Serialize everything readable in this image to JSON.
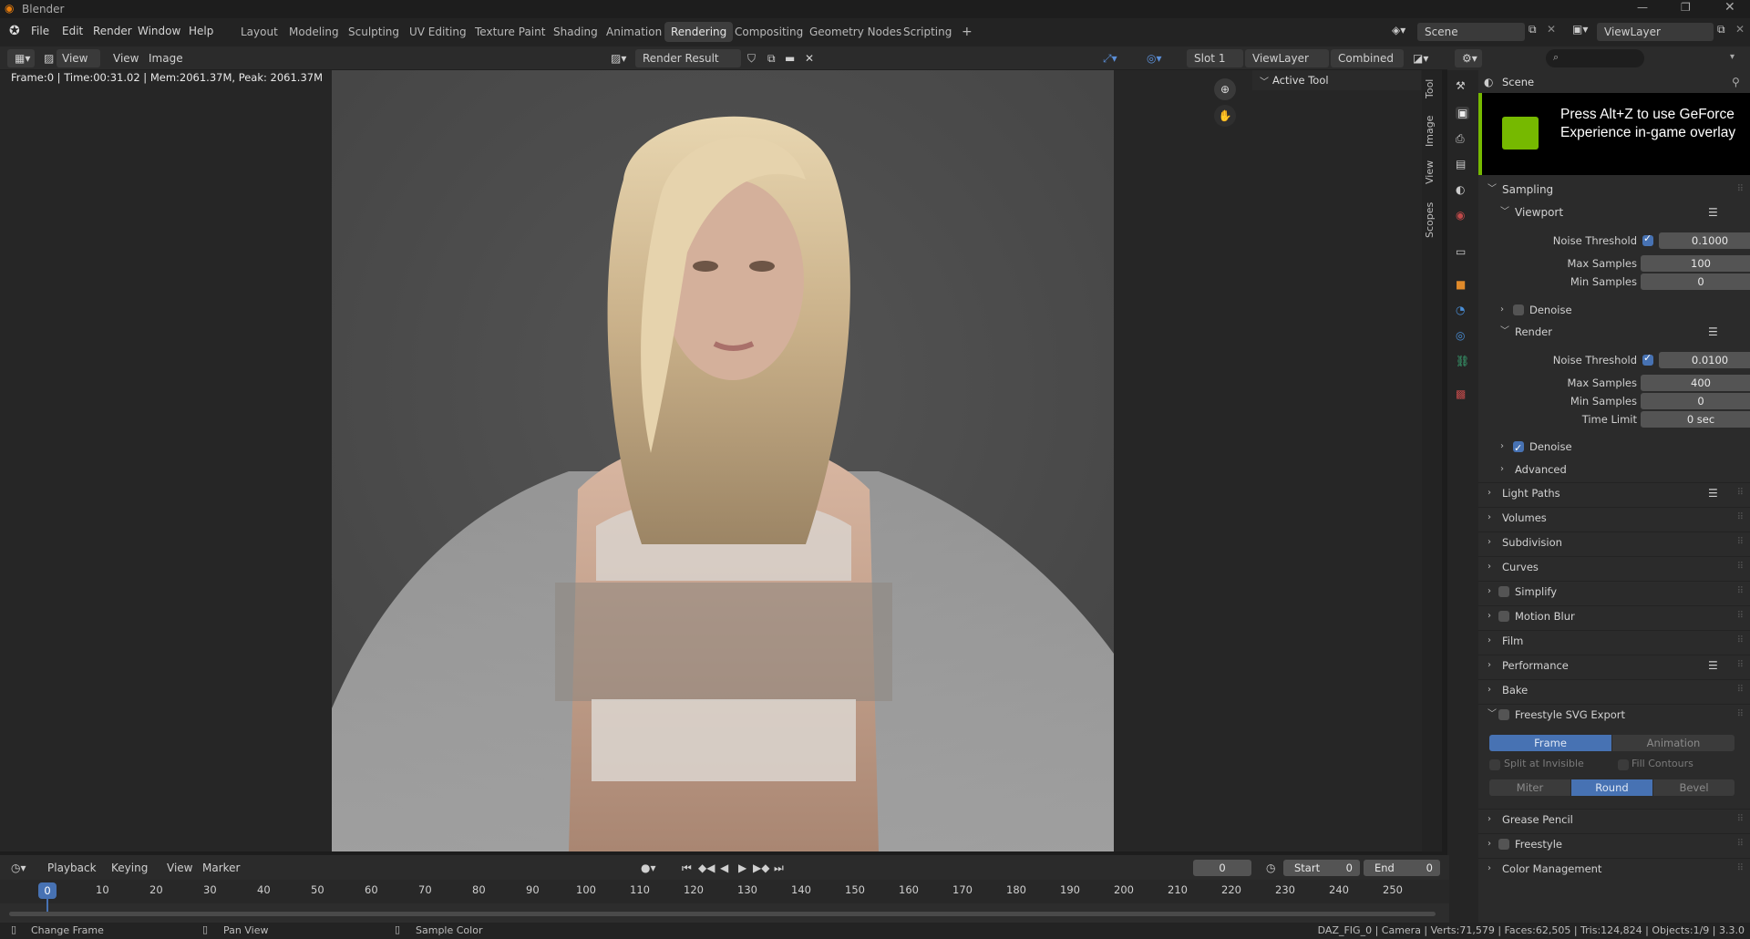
{
  "window": {
    "title": "Blender"
  },
  "menu": [
    "File",
    "Edit",
    "Render",
    "Window",
    "Help"
  ],
  "workspaces": {
    "tabs": [
      "Layout",
      "Modeling",
      "Sculpting",
      "UV Editing",
      "Texture Paint",
      "Shading",
      "Animation",
      "Rendering",
      "Compositing",
      "Geometry Nodes",
      "Scripting"
    ],
    "active": "Rendering",
    "add_label": "+"
  },
  "top_right": {
    "scene": "Scene",
    "view_layer": "ViewLayer"
  },
  "image_editor": {
    "view_menu": "View",
    "menu_view": "View",
    "menu_image": "Image",
    "image_name": "Render Result",
    "slot": "Slot 1",
    "view_layer": "ViewLayer",
    "pass": "Combined",
    "info": "Frame:0 | Time:00:31.02 | Mem:2061.37M, Peak: 2061.37M",
    "active_tool_label": "Active Tool",
    "vertical_tabs": [
      "Tool",
      "Image",
      "View",
      "Scopes"
    ]
  },
  "overlay": {
    "text": "Press Alt+Z to use GeForce Experience in-game overlay"
  },
  "properties": {
    "header": "Scene",
    "sampling": {
      "label": "Sampling",
      "viewport": {
        "label": "Viewport",
        "noise_threshold_label": "Noise Threshold",
        "noise_threshold": "0.1000",
        "max_samples_label": "Max Samples",
        "max_samples": "100",
        "min_samples_label": "Min Samples",
        "min_samples": "0",
        "denoise_label": "Denoise"
      },
      "render": {
        "label": "Render",
        "noise_threshold_label": "Noise Threshold",
        "noise_threshold": "0.0100",
        "max_samples_label": "Max Samples",
        "max_samples": "400",
        "min_samples_label": "Min Samples",
        "min_samples": "0",
        "time_limit_label": "Time Limit",
        "time_limit": "0 sec",
        "denoise_label": "Denoise"
      },
      "advanced_label": "Advanced"
    },
    "sections": {
      "light_paths": "Light Paths",
      "volumes": "Volumes",
      "subdivision": "Subdivision",
      "curves": "Curves",
      "simplify": "Simplify",
      "motion_blur": "Motion Blur",
      "film": "Film",
      "performance": "Performance",
      "bake": "Bake",
      "freestyle_svg": "Freestyle SVG Export",
      "grease_pencil": "Grease Pencil",
      "freestyle": "Freestyle",
      "color_management": "Color Management"
    },
    "svg_export": {
      "mode": [
        "Frame",
        "Animation"
      ],
      "split_at_invisible": "Split at Invisible",
      "fill_contours": "Fill Contours",
      "line_join": [
        "Miter",
        "Round",
        "Bevel"
      ]
    }
  },
  "timeline": {
    "menus": [
      "Playback",
      "Keying",
      "View",
      "Marker"
    ],
    "current_frame": "0",
    "start_label": "Start",
    "start": "0",
    "end_label": "End",
    "end": "0",
    "ruler": [
      "0",
      "10",
      "20",
      "30",
      "40",
      "50",
      "60",
      "70",
      "80",
      "90",
      "100",
      "110",
      "120",
      "130",
      "140",
      "150",
      "160",
      "170",
      "180",
      "190",
      "200",
      "210",
      "220",
      "230",
      "240",
      "250"
    ],
    "playhead": "0"
  },
  "status": {
    "left": [
      "Change Frame",
      "Pan View",
      "Sample Color"
    ],
    "right": "DAZ_FIG_0 | Camera | Verts:71,579 | Faces:62,505 | Tris:124,824 | Objects:1/9 | 3.3.0"
  },
  "colors": {
    "accent": "#4772b3",
    "nvidia_green": "#76b900",
    "background": "#262626"
  }
}
